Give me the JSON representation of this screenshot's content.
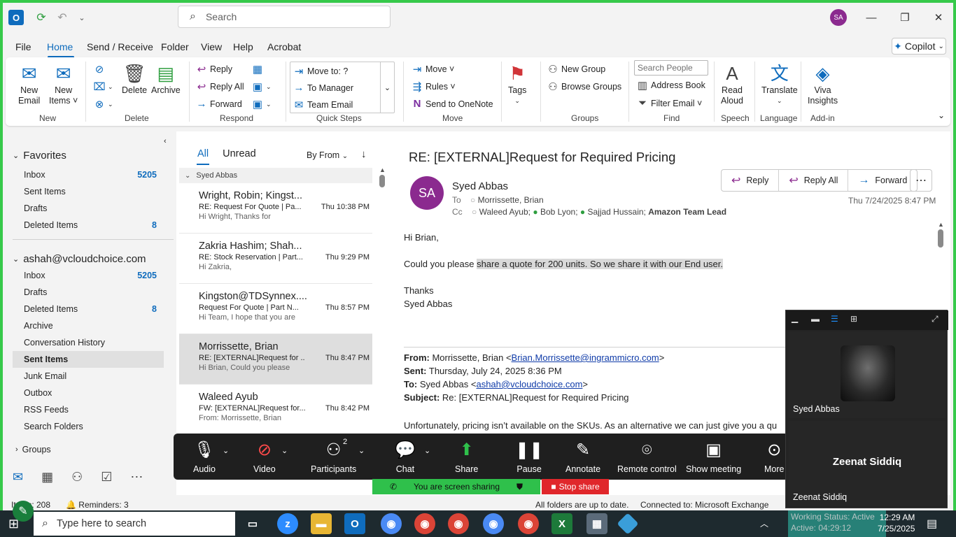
{
  "titlebar": {
    "search_placeholder": "Search",
    "avatar_initials": "SA"
  },
  "menu": {
    "items": [
      "File",
      "Home",
      "Send / Receive",
      "Folder",
      "View",
      "Help",
      "Acrobat"
    ],
    "copilot": "Copilot"
  },
  "ribbon": {
    "new_email": [
      "New",
      "Email"
    ],
    "new_items": [
      "New",
      "Items ˅"
    ],
    "delete": "Delete",
    "archive": "Archive",
    "reply": "Reply",
    "reply_all": "Reply All",
    "forward": "Forward",
    "quick_steps": [
      "Move to: ?",
      "To Manager",
      "Team Email"
    ],
    "move": "Move ˅",
    "rules": "Rules ˅",
    "onenote": "Send to OneNote",
    "tags": "Tags",
    "new_group": "New Group",
    "browse_groups": "Browse Groups",
    "search_people": "Search People",
    "address_book": "Address Book",
    "filter_email": "Filter Email ˅",
    "read_aloud": [
      "Read",
      "Aloud"
    ],
    "translate": "Translate",
    "viva": [
      "Viva",
      "Insights"
    ],
    "groups": [
      "New",
      "Delete",
      "Respond",
      "Quick Steps",
      "Move",
      "Groups",
      "Find",
      "Speech",
      "Language",
      "Add-in"
    ]
  },
  "folders": {
    "favorites_label": "Favorites",
    "favorites": [
      {
        "label": "Inbox",
        "count": "5205"
      },
      {
        "label": "Sent Items",
        "count": ""
      },
      {
        "label": "Drafts",
        "count": ""
      },
      {
        "label": "Deleted Items",
        "count": "8"
      }
    ],
    "account_label": "ashah@vcloudchoice.com",
    "account": [
      {
        "label": "Inbox",
        "count": "5205"
      },
      {
        "label": "Drafts",
        "count": ""
      },
      {
        "label": "Deleted Items",
        "count": "8"
      },
      {
        "label": "Archive",
        "count": ""
      },
      {
        "label": "Conversation History",
        "count": ""
      },
      {
        "label": "Sent Items",
        "count": ""
      },
      {
        "label": "Junk Email",
        "count": ""
      },
      {
        "label": "Outbox",
        "count": ""
      },
      {
        "label": "RSS Feeds",
        "count": ""
      },
      {
        "label": "Search Folders",
        "count": ""
      }
    ],
    "groups_label": "Groups"
  },
  "list": {
    "tab_all": "All",
    "tab_unread": "Unread",
    "sort": "By From",
    "group_header": "Syed Abbas",
    "messages": [
      {
        "from": "Wright, Robin; Kingst...",
        "subject": "RE: Request For Quote | Pa...",
        "time": "Thu 10:38 PM",
        "preview": "Hi Wright,  Thanks for"
      },
      {
        "from": "Zakria Hashim; Shah...",
        "subject": "RE: Stock Reservation | Part...",
        "time": "Thu 9:29 PM",
        "preview": "Hi Zakria,"
      },
      {
        "from": "Kingston@TDSynnex....",
        "subject": "Request For Quote | Part N...",
        "time": "Thu 8:57 PM",
        "preview": "Hi Team,  I hope that you are"
      },
      {
        "from": "Morrissette, Brian",
        "subject": "RE: [EXTERNAL]Request for ...",
        "time": "Thu 8:47 PM",
        "preview": "Hi Brian,  Could you please"
      },
      {
        "from": "Waleed Ayub",
        "subject": "FW: [EXTERNAL]Request for...",
        "time": "Thu 8:42 PM",
        "preview": "From: Morrissette, Brian"
      }
    ]
  },
  "reading": {
    "subject": "RE: [EXTERNAL]Request for Required Pricing",
    "sender_initials": "SA",
    "sender": "Syed Abbas",
    "to_label": "To",
    "to": "Morrissette, Brian",
    "cc_label": "Cc",
    "cc_1": "Waleed Ayub;",
    "cc_2": "Bob Lyon;",
    "cc_3": "Sajjad Hussain;",
    "cc_4": "Amazon Team Lead",
    "btn_reply": "Reply",
    "btn_reply_all": "Reply All",
    "btn_forward": "Forward",
    "date": "Thu 7/24/2025 8:47 PM",
    "greeting": "Hi Brian,",
    "body_start": "Could you please ",
    "body_highlight": "share a quote for 200 units. So we share it with our End user.",
    "thanks": "Thanks",
    "signature": "Syed Abbas",
    "from_label": "From:",
    "from_value": "Morrissette, Brian <",
    "from_email": "Brian.Morrissette@ingrammicro.com",
    "sent_label": "Sent:",
    "sent_value": "Thursday, July 24, 2025 8:36 PM",
    "to2_label": "To:",
    "to2_value": "Syed Abbas <",
    "to2_email": "ashah@vcloudchoice.com",
    "subject_label": "Subject:",
    "subject_value": "Re: [EXTERNAL]Request for Required Pricing",
    "body2": "Unfortunately, pricing isn’t available on the SKUs. As an alternative we can just give you a qu"
  },
  "zoom": {
    "audio": "Audio",
    "video": "Video",
    "participants": "Participants",
    "participants_count": "2",
    "chat": "Chat",
    "share": "Share",
    "pause": "Pause",
    "annotate": "Annotate",
    "remote": "Remote control",
    "show_meeting": "Show meeting",
    "more": "More",
    "sharing": "You are screen sharing",
    "stop": "Stop share"
  },
  "video_panel": {
    "tile1_name": "Syed Abbas",
    "tile2_center": "Zeenat Siddiq",
    "tile2_name": "Zeenat Siddiq"
  },
  "status": {
    "items": "Items: 208",
    "reminders": "Reminders: 3",
    "folders": "All folders are up to date.",
    "connected": "Connected to: Microsoft Exchange",
    "working": "Working Status: Active",
    "active": "Active: 04:29:12"
  },
  "taskbar": {
    "search": "Type here to search",
    "time": "12:29 AM",
    "date": "7/25/2025"
  },
  "colors": {
    "accent": "#0f6cbd",
    "zoom_green": "#2fc04b",
    "stop_red": "#e0272b",
    "border_green": "#36c94a"
  }
}
